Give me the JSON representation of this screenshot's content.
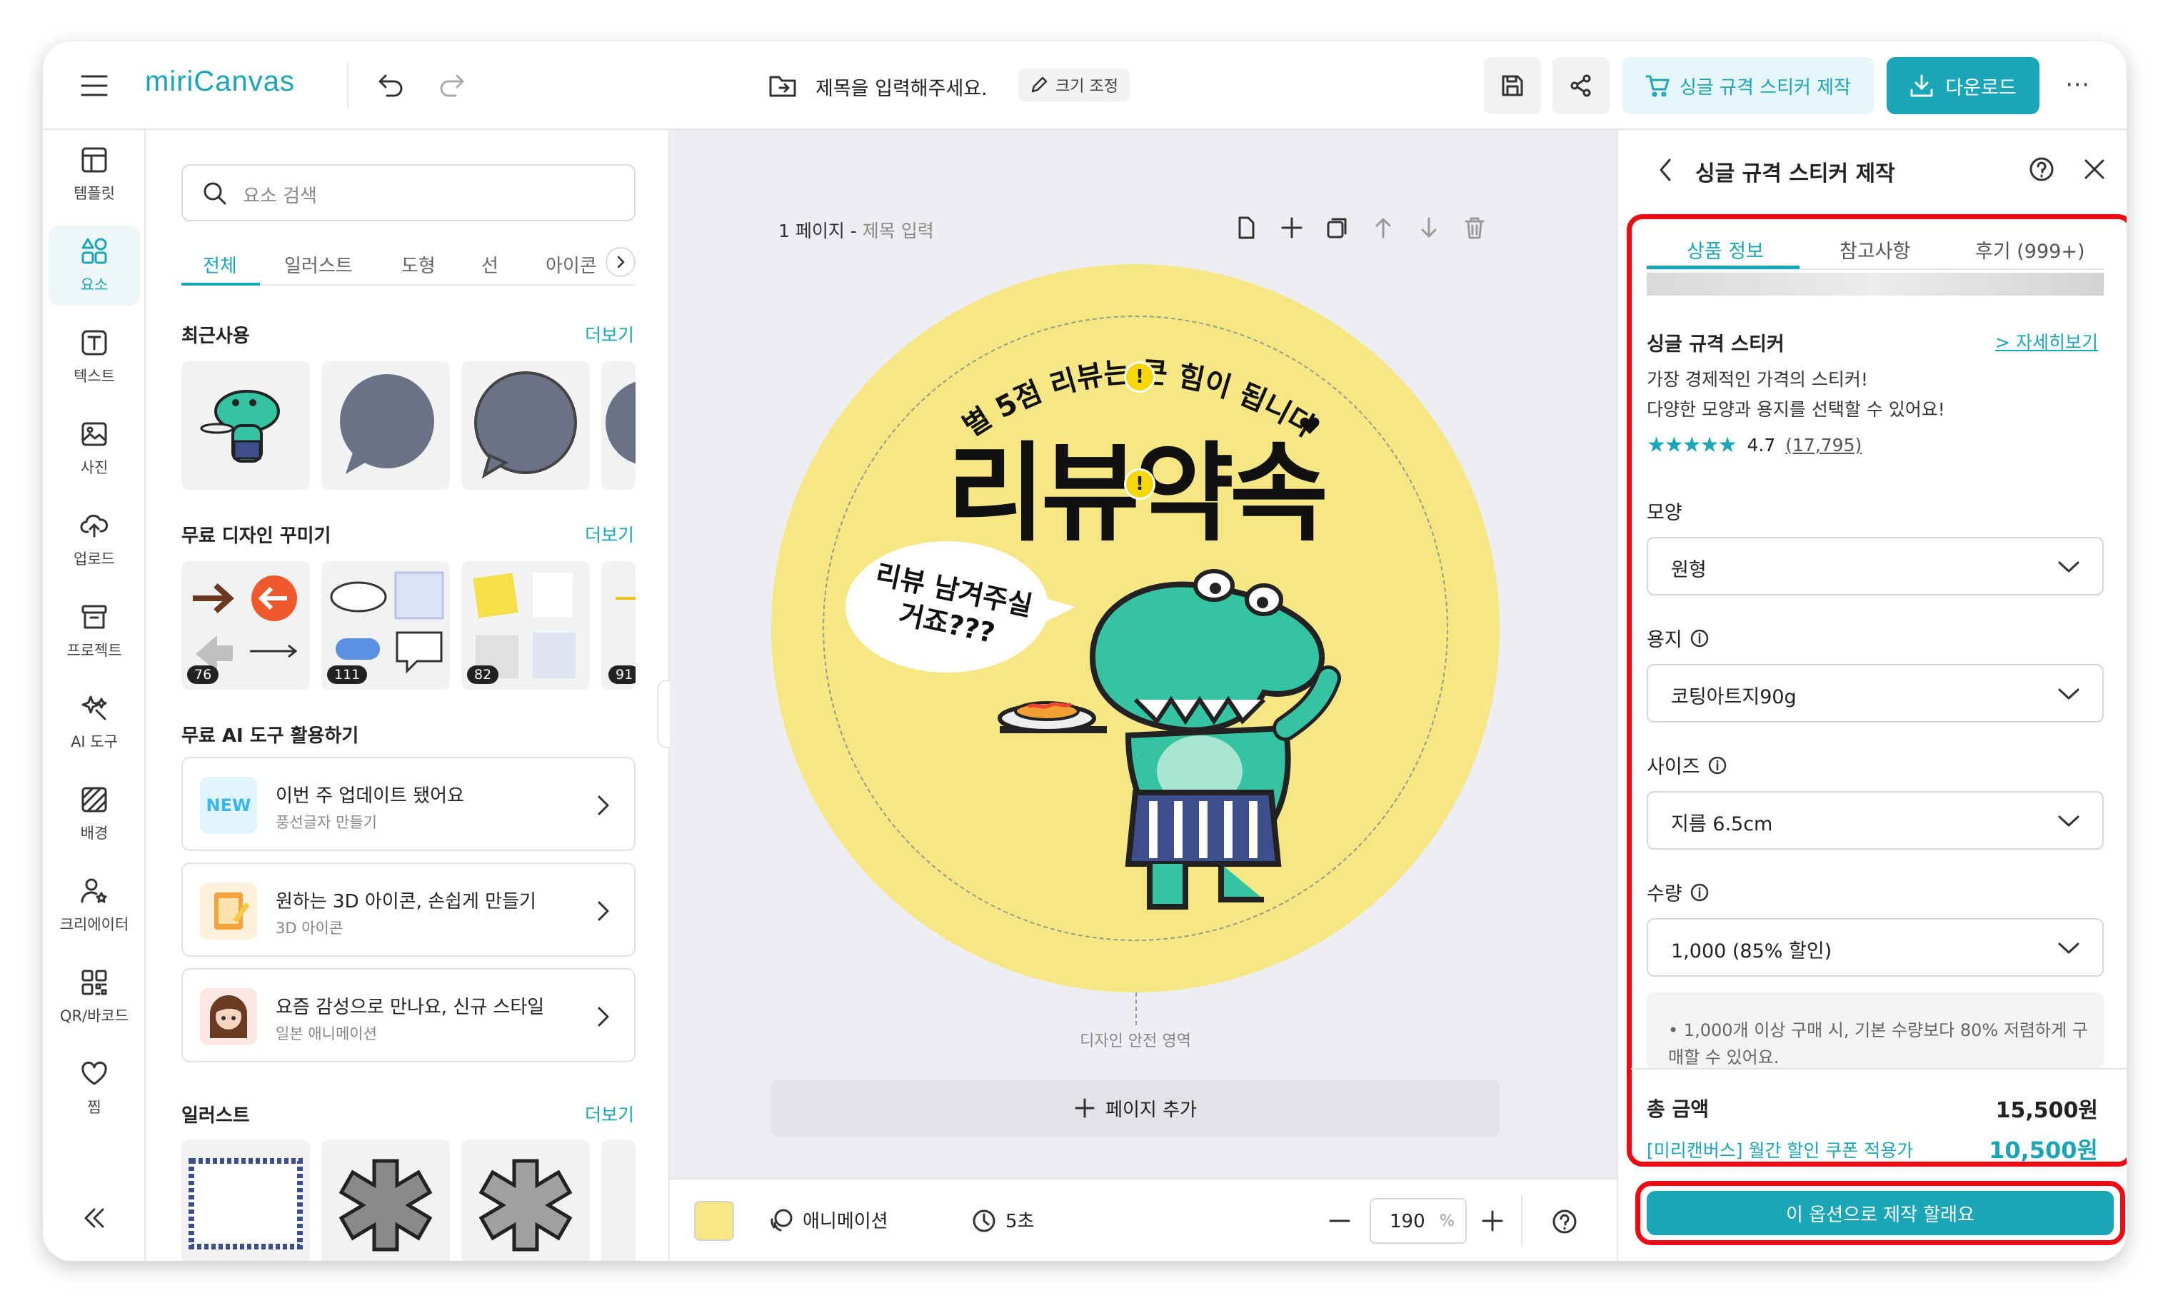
{
  "app": {
    "logo": "miriCanvas"
  },
  "topbar": {
    "document_title": "제목을 입력해주세요.",
    "resize_label": "크기 조정",
    "sticker_button": "싱글 규격 스티커 제작",
    "download_button": "다운로드",
    "icons": [
      "menu-icon",
      "undo-icon",
      "redo-icon",
      "folder-icon",
      "save-icon",
      "share-icon",
      "cart-icon",
      "download-icon",
      "more-icon"
    ]
  },
  "sidebar": {
    "items": [
      {
        "label": "템플릿",
        "icon": "template-icon"
      },
      {
        "label": "요소",
        "icon": "elements-icon"
      },
      {
        "label": "텍스트",
        "icon": "text-icon"
      },
      {
        "label": "사진",
        "icon": "photo-icon"
      },
      {
        "label": "업로드",
        "icon": "upload-icon"
      },
      {
        "label": "프로젝트",
        "icon": "project-icon"
      },
      {
        "label": "AI 도구",
        "icon": "ai-tools-icon"
      },
      {
        "label": "배경",
        "icon": "background-icon"
      },
      {
        "label": "크리에이터",
        "icon": "creator-icon"
      },
      {
        "label": "QR/바코드",
        "icon": "qr-icon"
      },
      {
        "label": "찜",
        "icon": "heart-icon"
      }
    ],
    "active_index": 1
  },
  "panel": {
    "search_placeholder": "요소 검색",
    "tabs": [
      "전체",
      "일러스트",
      "도형",
      "선",
      "아이콘"
    ],
    "active_tab": 0,
    "recent_title": "최근사용",
    "more_label": "더보기",
    "decorate_title": "무료 디자인 꾸미기",
    "decorate_badges": [
      "76",
      "111",
      "82",
      "91"
    ],
    "ai_title": "무료 AI 도구 활용하기",
    "ai_cards": [
      {
        "title": "이번 주 업데이트 됐어요",
        "subtitle": "풍선글자 만들기",
        "icon_text": "NEW"
      },
      {
        "title": "원하는 3D 아이콘, 손쉽게 만들기",
        "subtitle": "3D 아이콘"
      },
      {
        "title": "요즘 감성으로 만나요, 신규 스타일",
        "subtitle": "일본 애니메이션"
      }
    ],
    "illust_title": "일러스트"
  },
  "canvas": {
    "page_label": "1 페이지 -",
    "page_title_placeholder": "제목 입력",
    "sticker": {
      "arc_text": "별 5점 리뷰는 큰 힘이 됩니다",
      "main_text": "리뷰약속",
      "bubble_line1": "리뷰 남겨주실",
      "bubble_line2": "거죠???",
      "bg_color": "#f6e784"
    },
    "safe_area_label": "디자인 안전 영역",
    "add_page": "페이지 추가"
  },
  "bottombar": {
    "swatch_color": "#f6e784",
    "animation_label": "애니메이션",
    "duration_label": "5초",
    "zoom_value": "190",
    "zoom_unit": "%"
  },
  "right_panel": {
    "title": "싱글 규격 스티커 제작",
    "tabs": [
      "상품 정보",
      "참고사항",
      "후기 (999+)"
    ],
    "active_tab": 0,
    "product_name": "싱글 규격 스티커",
    "detail_link": "> 자세히보기",
    "desc_line1": "가장 경제적인 가격의 스티커!",
    "desc_line2": "다양한 모양과 용지를 선택할 수 있어요!",
    "rating": "4.7",
    "review_count": "(17,795)",
    "stars": 5,
    "shape_label": "모양",
    "shape_value": "원형",
    "paper_label": "용지",
    "paper_value": "코팅아트지90g",
    "size_label": "사이즈",
    "size_value": "지름 6.5cm",
    "qty_label": "수량",
    "qty_value": "1,000 (85% 할인)",
    "notice": "1,000개 이상 구매 시, 기본 수량보다 80% 저렴하게 구매할 수 있어요.",
    "total_label": "총 금액",
    "total_value": "15,500원",
    "coupon_label": "[미리캔버스] 월간 할인 쿠폰 적용가",
    "coupon_value": "10,500원",
    "cta": "이 옵션으로 제작 할래요",
    "accent_color": "#1aa6b6",
    "highlight_color": "#ee0a12"
  }
}
